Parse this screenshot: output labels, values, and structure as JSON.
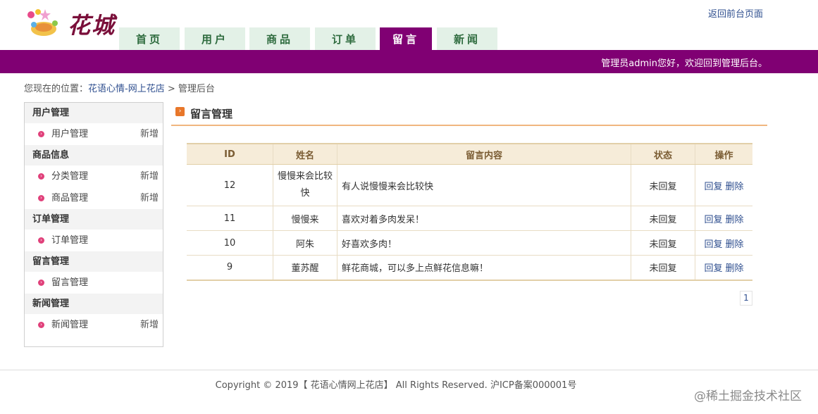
{
  "header": {
    "logo_text": "花城",
    "front_link": "返回前台页面",
    "welcome": "管理员admin您好，欢迎回到管理后台。"
  },
  "nav": {
    "tabs": [
      {
        "label": "首页"
      },
      {
        "label": "用户"
      },
      {
        "label": "商品"
      },
      {
        "label": "订单"
      },
      {
        "label": "留言",
        "active": true
      },
      {
        "label": "新闻"
      }
    ]
  },
  "breadcrumb": {
    "prefix": "您现在的位置：",
    "site": "花语心情-网上花店",
    "sep": ">",
    "current": "管理后台"
  },
  "sidebar": {
    "groups": [
      {
        "title": "用户管理",
        "items": [
          {
            "label": "用户管理",
            "add": "新增"
          }
        ]
      },
      {
        "title": "商品信息",
        "items": [
          {
            "label": "分类管理",
            "add": "新增"
          },
          {
            "label": "商品管理",
            "add": "新增"
          }
        ]
      },
      {
        "title": "订单管理",
        "items": [
          {
            "label": "订单管理"
          }
        ]
      },
      {
        "title": "留言管理",
        "items": [
          {
            "label": "留言管理"
          }
        ]
      },
      {
        "title": "新闻管理",
        "items": [
          {
            "label": "新闻管理",
            "add": "新增"
          }
        ]
      }
    ]
  },
  "main": {
    "title": "留言管理",
    "columns": [
      "ID",
      "姓名",
      "留言内容",
      "状态",
      "操作"
    ],
    "rows": [
      {
        "id": "12",
        "name": "慢慢来会比较快",
        "content": "有人说慢慢来会比较快",
        "status": "未回复",
        "reply": "回复",
        "delete": "删除"
      },
      {
        "id": "11",
        "name": "慢慢来",
        "content": "喜欢对着多肉发呆！",
        "status": "未回复",
        "reply": "回复",
        "delete": "删除"
      },
      {
        "id": "10",
        "name": "阿朱",
        "content": "好喜欢多肉！",
        "status": "未回复",
        "reply": "回复",
        "delete": "删除"
      },
      {
        "id": "9",
        "name": "董苏醒",
        "content": "鲜花商城，可以多上点鲜花信息嘛！",
        "status": "未回复",
        "reply": "回复",
        "delete": "删除"
      }
    ],
    "page": "1"
  },
  "footer": {
    "text": "Copyright © 2019【 花语心情网上花店】 All Rights Reserved. 沪ICP备案000001号"
  },
  "watermark": "@稀土掘金技术社区",
  "colors": {
    "brand_purple": "#800073",
    "tab_green": "#e3f1e7",
    "accent_orange": "#e8772a"
  }
}
